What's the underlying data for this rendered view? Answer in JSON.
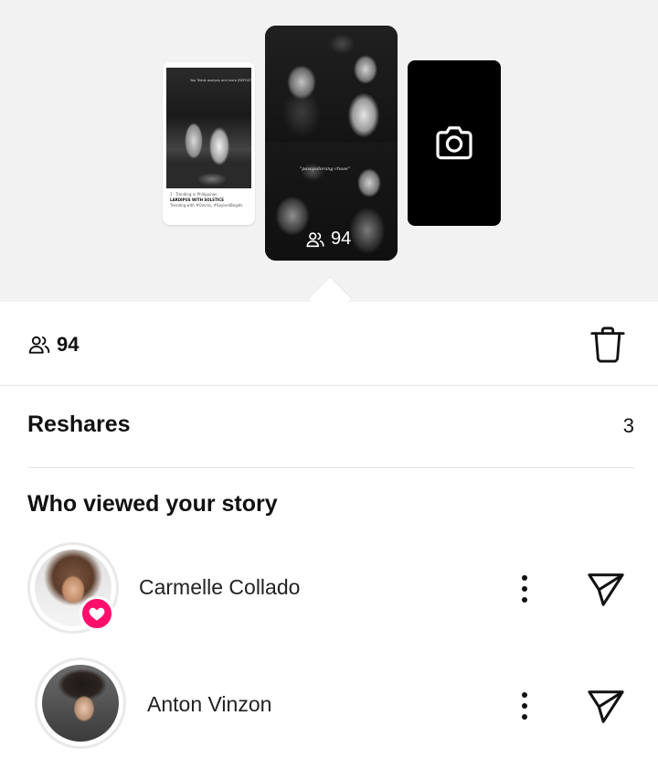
{
  "preview": {
    "left_story": {
      "top_line": "Yap Tiktok analysis and more (REPOST)",
      "caption_line_1": "1 · Trending in Philippines",
      "caption_line_2": "LARDIPUS WITH SOLSTICE",
      "caption_line_3": "Trending with #Oinchs, #SoylentBogids"
    },
    "center_story": {
      "caption": "\"pasapalorang chase\"",
      "views": "94"
    },
    "right_story": {
      "icon": "camera-icon"
    }
  },
  "stats": {
    "views_icon": "viewers-icon",
    "views_count": "94",
    "delete_icon": "trash-icon"
  },
  "reshares": {
    "label": "Reshares",
    "count": "3"
  },
  "viewers": {
    "heading": "Who viewed your story",
    "items": [
      {
        "name": "Carmelle Collado",
        "liked": true,
        "more_icon": "more-vertical-icon",
        "send_icon": "send-icon"
      },
      {
        "name": "Anton Vinzon",
        "liked": false,
        "more_icon": "more-vertical-icon",
        "send_icon": "send-icon"
      }
    ]
  },
  "colors": {
    "like_badge": "#ff0f6b",
    "preview_bg": "#f2f2f2",
    "divider": "#e6e6e6"
  }
}
